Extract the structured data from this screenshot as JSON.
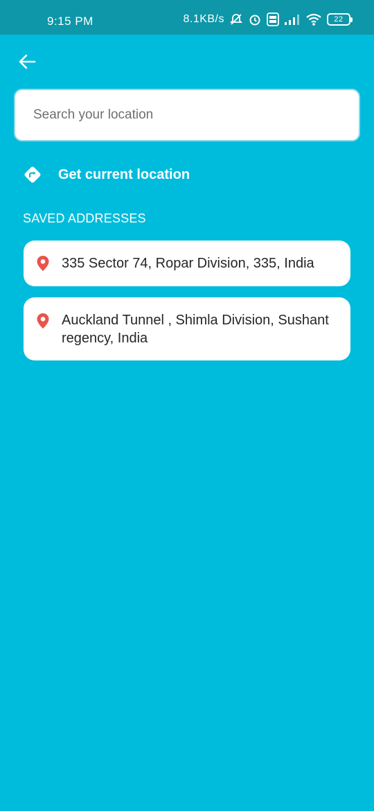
{
  "status_bar": {
    "time": "9:15 PM",
    "network_speed": "8.1KB/s",
    "battery_level": "22",
    "icons": [
      "alarm-off-icon",
      "alarm-icon",
      "volte-icon",
      "signal-icon",
      "wifi-icon",
      "battery-icon"
    ]
  },
  "header": {
    "back_icon": "arrow-left-icon"
  },
  "search": {
    "placeholder": "Search your location",
    "value": ""
  },
  "current_location": {
    "icon": "directions-icon",
    "label": "Get current location"
  },
  "saved_addresses": {
    "heading": "SAVED ADDRESSES",
    "items": [
      {
        "icon": "map-pin-icon",
        "text": "335 Sector 74, Ropar Division, 335, India"
      },
      {
        "icon": "map-pin-icon",
        "text": "Auckland Tunnel , Shimla Division, Sushant regency, India"
      }
    ]
  },
  "colors": {
    "background": "#00BCDC",
    "status_bar": "#0D97A8",
    "pin": "#E9544B",
    "card": "#FFFFFF"
  }
}
